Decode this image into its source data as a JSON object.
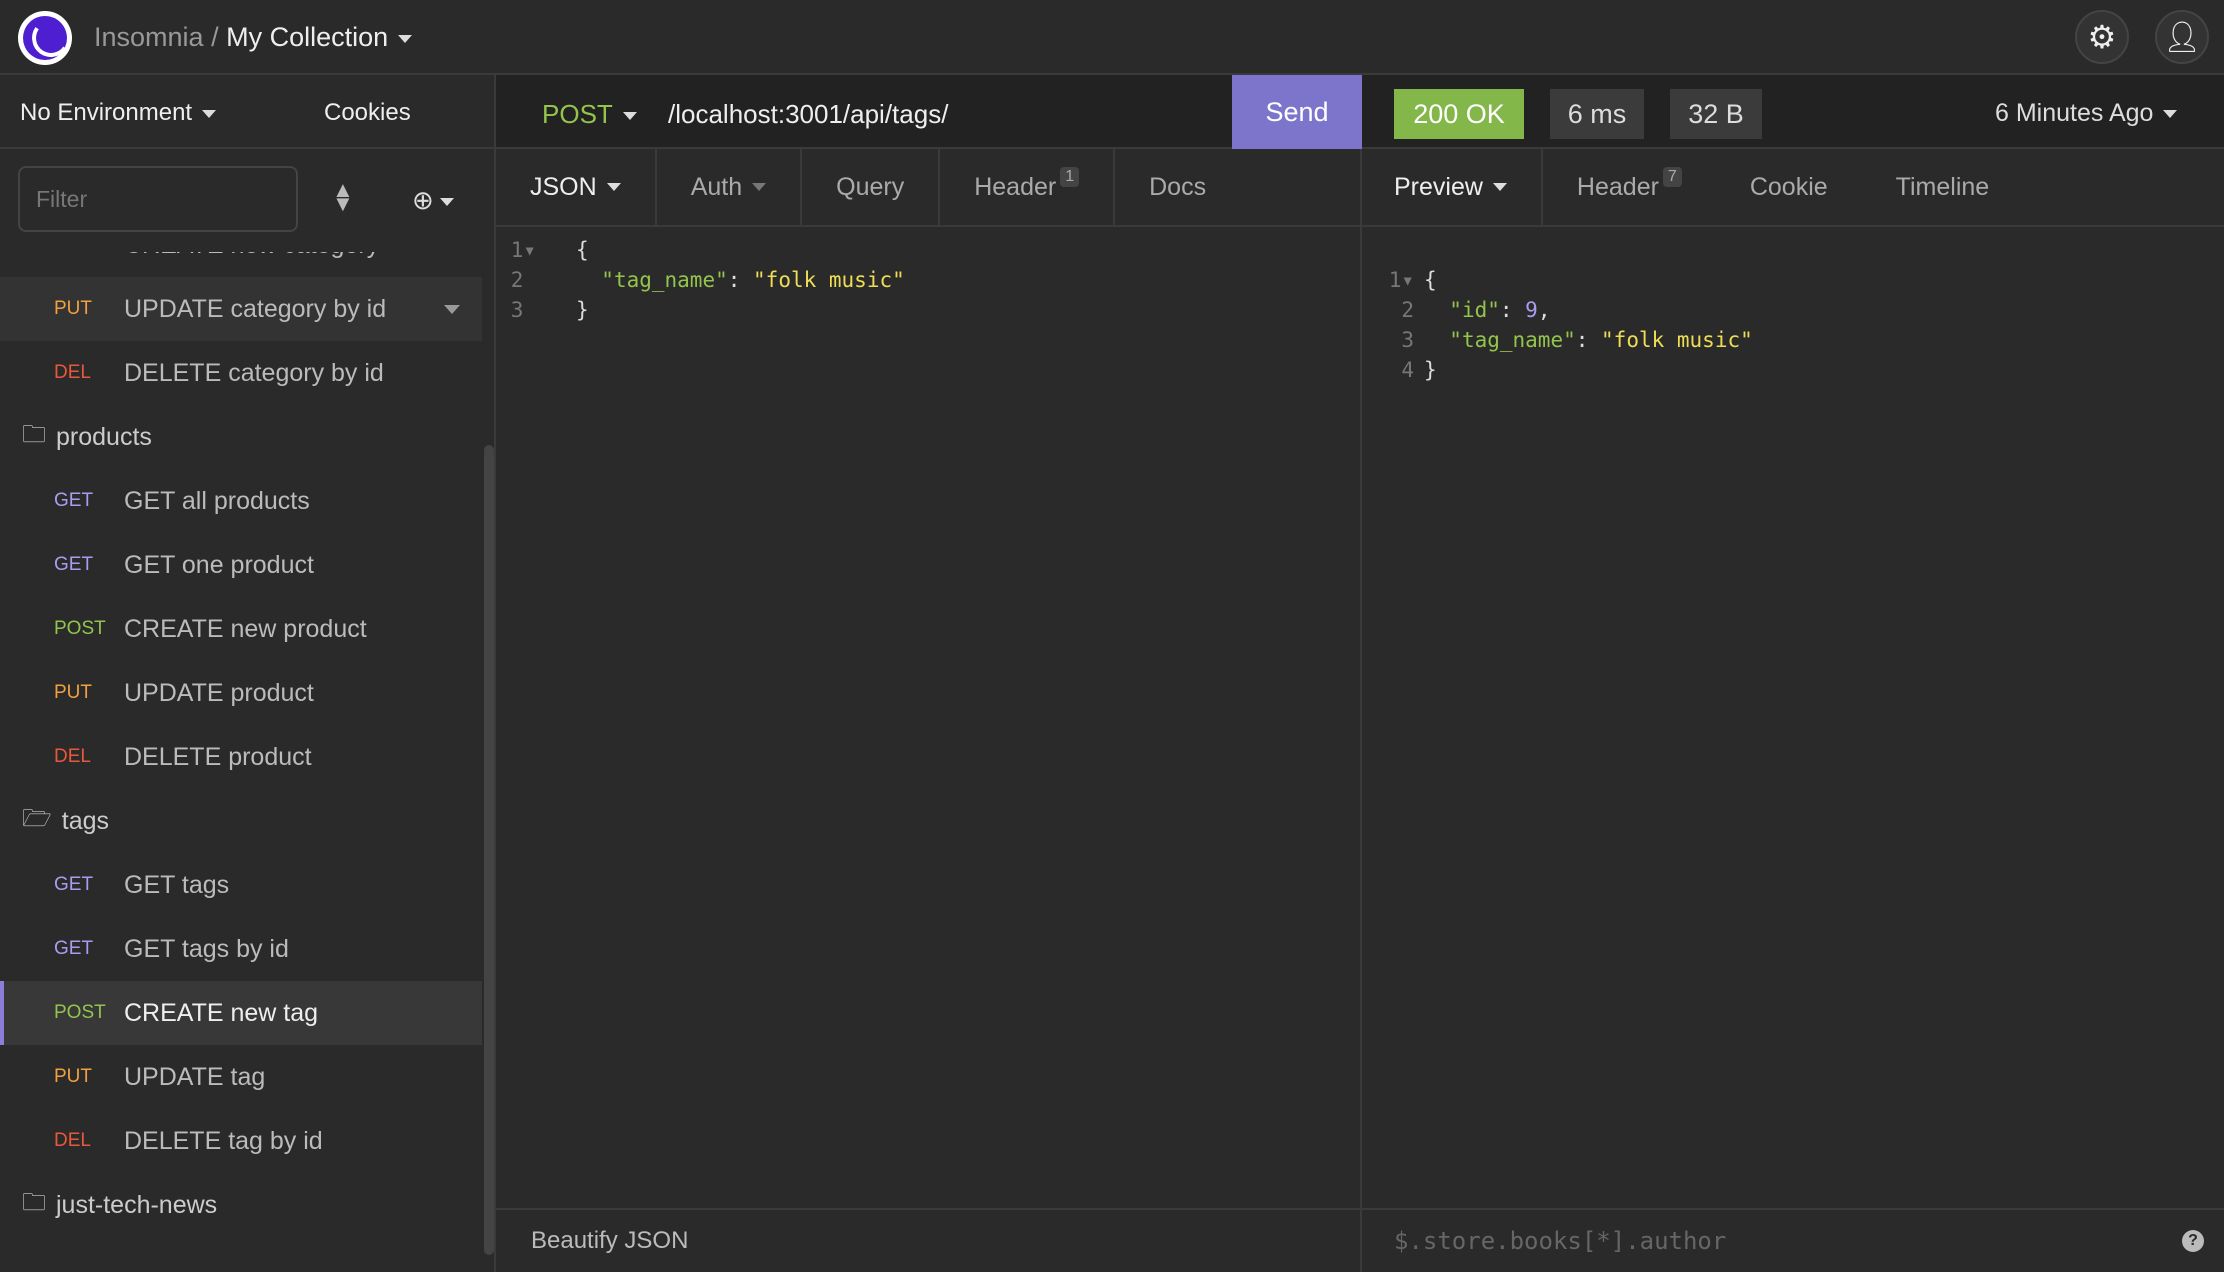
{
  "topbar": {
    "app": "Insomnia",
    "separator": "/",
    "collection": "My Collection"
  },
  "sidebar": {
    "environment": "No Environment",
    "cookies": "Cookies",
    "filter_placeholder": "Filter",
    "items": [
      {
        "type": "request",
        "method": "POST",
        "label": "CREATE new category"
      },
      {
        "type": "request",
        "method": "PUT",
        "label": "UPDATE category by id",
        "hover": true
      },
      {
        "type": "request",
        "method": "DEL",
        "label": "DELETE category by id"
      },
      {
        "type": "folder",
        "label": "products",
        "open": false
      },
      {
        "type": "request",
        "method": "GET",
        "label": "GET all products"
      },
      {
        "type": "request",
        "method": "GET",
        "label": "GET one product"
      },
      {
        "type": "request",
        "method": "POST",
        "label": "CREATE new product"
      },
      {
        "type": "request",
        "method": "PUT",
        "label": "UPDATE product"
      },
      {
        "type": "request",
        "method": "DEL",
        "label": "DELETE product"
      },
      {
        "type": "folder",
        "label": "tags",
        "open": true
      },
      {
        "type": "request",
        "method": "GET",
        "label": "GET tags"
      },
      {
        "type": "request",
        "method": "GET",
        "label": "GET tags by id"
      },
      {
        "type": "request",
        "method": "POST",
        "label": "CREATE new tag",
        "selected": true
      },
      {
        "type": "request",
        "method": "PUT",
        "label": "UPDATE tag"
      },
      {
        "type": "request",
        "method": "DEL",
        "label": "DELETE tag by id"
      },
      {
        "type": "folder",
        "label": "just-tech-news",
        "open": false
      }
    ]
  },
  "method_colors": {
    "GET": "#a89ef0",
    "POST": "#93c44b",
    "PUT": "#f0a040",
    "DEL": "#e8583a"
  },
  "request": {
    "method": "POST",
    "url": "/localhost:3001/api/tags/",
    "send": "Send",
    "tabs": {
      "body": "JSON",
      "auth": "Auth",
      "query": "Query",
      "header": "Header",
      "header_count": "1",
      "docs": "Docs"
    },
    "body_lines": [
      [
        "1",
        "{"
      ],
      [
        "2",
        "  \"tag_name\": \"folk music\""
      ],
      [
        "3",
        "}"
      ]
    ],
    "footer": "Beautify JSON"
  },
  "response": {
    "status": "200 OK",
    "status_color": "#84b749",
    "time": "6 ms",
    "size": "32 B",
    "history": "6 Minutes Ago",
    "tabs": {
      "preview": "Preview",
      "header": "Header",
      "header_count": "7",
      "cookie": "Cookie",
      "timeline": "Timeline"
    },
    "filter_placeholder": "$.store.books[*].author",
    "help": "?"
  }
}
